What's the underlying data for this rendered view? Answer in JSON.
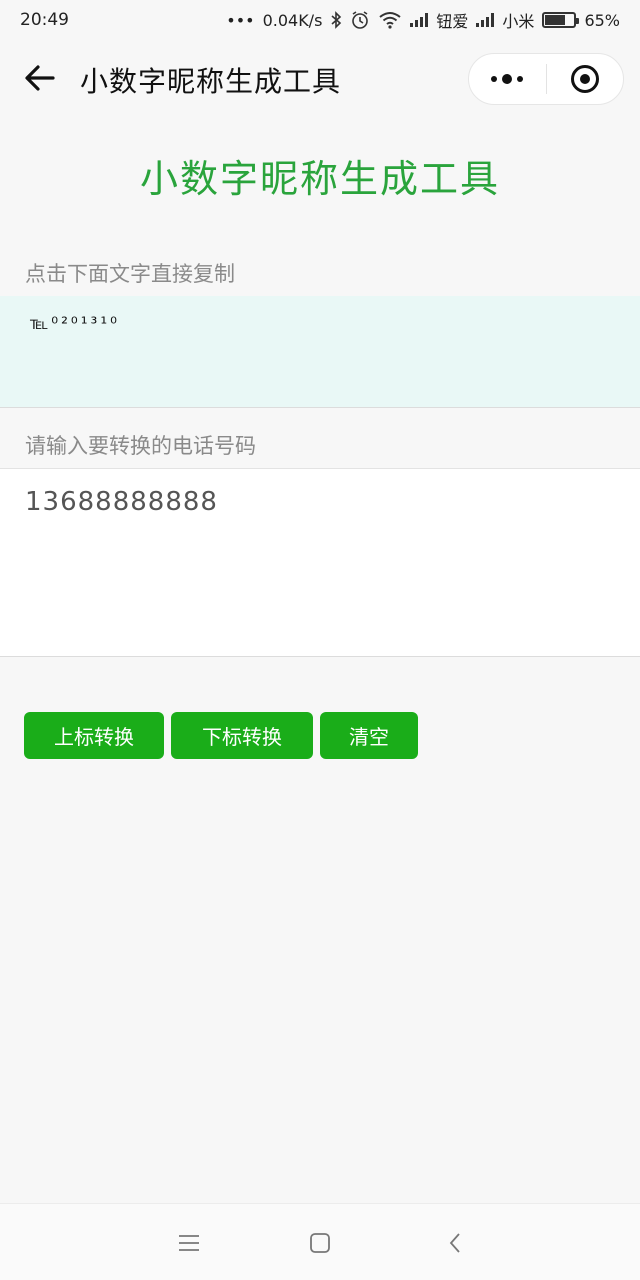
{
  "status_bar": {
    "time": "20:49",
    "dots": "•••",
    "speed": "0.04K/s",
    "carrier1": "钮爱",
    "carrier2": "小米",
    "battery": "65%",
    "battery_level": 0.65
  },
  "nav": {
    "title": "小数字昵称生成工具"
  },
  "main": {
    "heading": "小数字昵称生成工具",
    "copy_hint": "点击下面文字直接复制",
    "result_text": "℡⁰²⁰¹³¹⁰",
    "input_label": "请输入要转换的电话号码",
    "input_value": "13688888888"
  },
  "buttons": {
    "superscript": "上标转换",
    "subscript": "下标转换",
    "clear": "清空"
  },
  "colors": {
    "accent_green": "#1aad19",
    "heading_green": "#2aa43c",
    "result_bg": "#e9f8f6"
  }
}
